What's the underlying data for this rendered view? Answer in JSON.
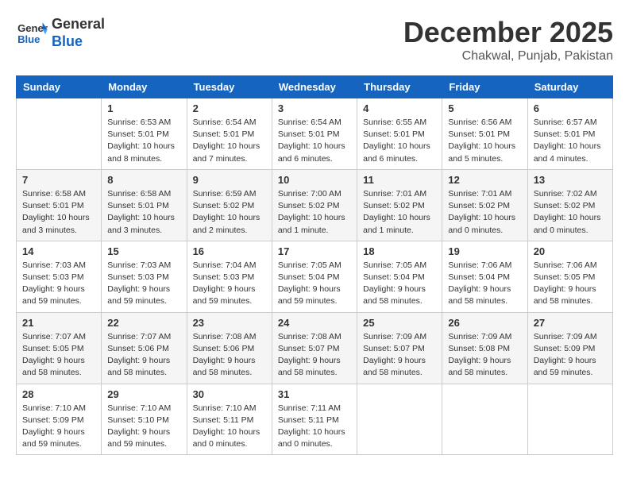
{
  "logo": {
    "line1": "General",
    "line2": "Blue"
  },
  "title": "December 2025",
  "location": "Chakwal, Punjab, Pakistan",
  "days_of_week": [
    "Sunday",
    "Monday",
    "Tuesday",
    "Wednesday",
    "Thursday",
    "Friday",
    "Saturday"
  ],
  "weeks": [
    [
      {
        "num": "",
        "info": ""
      },
      {
        "num": "1",
        "info": "Sunrise: 6:53 AM\nSunset: 5:01 PM\nDaylight: 10 hours\nand 8 minutes."
      },
      {
        "num": "2",
        "info": "Sunrise: 6:54 AM\nSunset: 5:01 PM\nDaylight: 10 hours\nand 7 minutes."
      },
      {
        "num": "3",
        "info": "Sunrise: 6:54 AM\nSunset: 5:01 PM\nDaylight: 10 hours\nand 6 minutes."
      },
      {
        "num": "4",
        "info": "Sunrise: 6:55 AM\nSunset: 5:01 PM\nDaylight: 10 hours\nand 6 minutes."
      },
      {
        "num": "5",
        "info": "Sunrise: 6:56 AM\nSunset: 5:01 PM\nDaylight: 10 hours\nand 5 minutes."
      },
      {
        "num": "6",
        "info": "Sunrise: 6:57 AM\nSunset: 5:01 PM\nDaylight: 10 hours\nand 4 minutes."
      }
    ],
    [
      {
        "num": "7",
        "info": "Sunrise: 6:58 AM\nSunset: 5:01 PM\nDaylight: 10 hours\nand 3 minutes."
      },
      {
        "num": "8",
        "info": "Sunrise: 6:58 AM\nSunset: 5:01 PM\nDaylight: 10 hours\nand 3 minutes."
      },
      {
        "num": "9",
        "info": "Sunrise: 6:59 AM\nSunset: 5:02 PM\nDaylight: 10 hours\nand 2 minutes."
      },
      {
        "num": "10",
        "info": "Sunrise: 7:00 AM\nSunset: 5:02 PM\nDaylight: 10 hours\nand 1 minute."
      },
      {
        "num": "11",
        "info": "Sunrise: 7:01 AM\nSunset: 5:02 PM\nDaylight: 10 hours\nand 1 minute."
      },
      {
        "num": "12",
        "info": "Sunrise: 7:01 AM\nSunset: 5:02 PM\nDaylight: 10 hours\nand 0 minutes."
      },
      {
        "num": "13",
        "info": "Sunrise: 7:02 AM\nSunset: 5:02 PM\nDaylight: 10 hours\nand 0 minutes."
      }
    ],
    [
      {
        "num": "14",
        "info": "Sunrise: 7:03 AM\nSunset: 5:03 PM\nDaylight: 9 hours\nand 59 minutes."
      },
      {
        "num": "15",
        "info": "Sunrise: 7:03 AM\nSunset: 5:03 PM\nDaylight: 9 hours\nand 59 minutes."
      },
      {
        "num": "16",
        "info": "Sunrise: 7:04 AM\nSunset: 5:03 PM\nDaylight: 9 hours\nand 59 minutes."
      },
      {
        "num": "17",
        "info": "Sunrise: 7:05 AM\nSunset: 5:04 PM\nDaylight: 9 hours\nand 59 minutes."
      },
      {
        "num": "18",
        "info": "Sunrise: 7:05 AM\nSunset: 5:04 PM\nDaylight: 9 hours\nand 58 minutes."
      },
      {
        "num": "19",
        "info": "Sunrise: 7:06 AM\nSunset: 5:04 PM\nDaylight: 9 hours\nand 58 minutes."
      },
      {
        "num": "20",
        "info": "Sunrise: 7:06 AM\nSunset: 5:05 PM\nDaylight: 9 hours\nand 58 minutes."
      }
    ],
    [
      {
        "num": "21",
        "info": "Sunrise: 7:07 AM\nSunset: 5:05 PM\nDaylight: 9 hours\nand 58 minutes."
      },
      {
        "num": "22",
        "info": "Sunrise: 7:07 AM\nSunset: 5:06 PM\nDaylight: 9 hours\nand 58 minutes."
      },
      {
        "num": "23",
        "info": "Sunrise: 7:08 AM\nSunset: 5:06 PM\nDaylight: 9 hours\nand 58 minutes."
      },
      {
        "num": "24",
        "info": "Sunrise: 7:08 AM\nSunset: 5:07 PM\nDaylight: 9 hours\nand 58 minutes."
      },
      {
        "num": "25",
        "info": "Sunrise: 7:09 AM\nSunset: 5:07 PM\nDaylight: 9 hours\nand 58 minutes."
      },
      {
        "num": "26",
        "info": "Sunrise: 7:09 AM\nSunset: 5:08 PM\nDaylight: 9 hours\nand 58 minutes."
      },
      {
        "num": "27",
        "info": "Sunrise: 7:09 AM\nSunset: 5:09 PM\nDaylight: 9 hours\nand 59 minutes."
      }
    ],
    [
      {
        "num": "28",
        "info": "Sunrise: 7:10 AM\nSunset: 5:09 PM\nDaylight: 9 hours\nand 59 minutes."
      },
      {
        "num": "29",
        "info": "Sunrise: 7:10 AM\nSunset: 5:10 PM\nDaylight: 9 hours\nand 59 minutes."
      },
      {
        "num": "30",
        "info": "Sunrise: 7:10 AM\nSunset: 5:11 PM\nDaylight: 10 hours\nand 0 minutes."
      },
      {
        "num": "31",
        "info": "Sunrise: 7:11 AM\nSunset: 5:11 PM\nDaylight: 10 hours\nand 0 minutes."
      },
      {
        "num": "",
        "info": ""
      },
      {
        "num": "",
        "info": ""
      },
      {
        "num": "",
        "info": ""
      }
    ]
  ]
}
